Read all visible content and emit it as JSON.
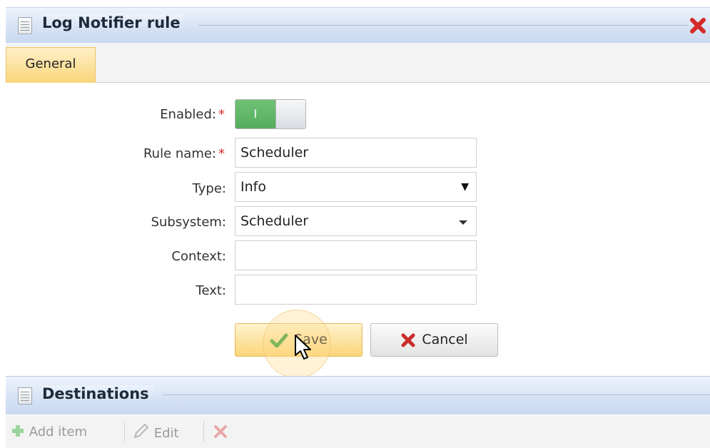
{
  "window": {
    "title": "Log Notifier rule",
    "close_icon": "close-icon"
  },
  "tabs": [
    {
      "label": "General",
      "active": true
    }
  ],
  "form": {
    "enabled": {
      "label": "Enabled:",
      "required": "*",
      "toggle_text": "I",
      "value": true
    },
    "rule_name": {
      "label": "Rule name:",
      "required": "*",
      "value": "Scheduler"
    },
    "type": {
      "label": "Type:",
      "value": "Info"
    },
    "subsystem": {
      "label": "Subsystem:",
      "value": "Scheduler"
    },
    "context": {
      "label": "Context:",
      "value": ""
    },
    "text": {
      "label": "Text:",
      "value": ""
    }
  },
  "buttons": {
    "save": "Save",
    "cancel": "Cancel"
  },
  "destinations": {
    "title": "Destinations",
    "toolbar": {
      "add": "Add item",
      "edit": "Edit"
    }
  },
  "colors": {
    "header_gradient_top": "#eef3fb",
    "header_gradient_bottom": "#c8d8f0",
    "active_tab": "#fad67a",
    "toggle_on": "#56ad5e",
    "required": "#d62a2a",
    "close_red": "#d62a2a"
  }
}
